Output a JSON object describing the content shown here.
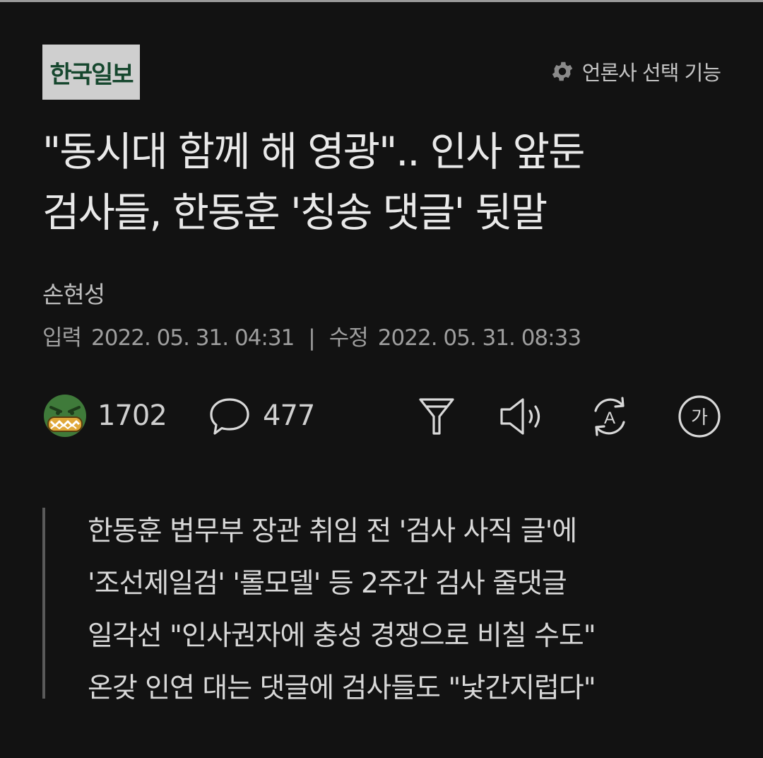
{
  "header": {
    "logo_text": "한국일보",
    "press_select_label": "언론사 선택 기능",
    "press_select_icon": "gear-icon"
  },
  "article": {
    "headline_line1": "\"동시대 함께 해 영광\".. 인사 앞둔",
    "headline_line2": "검사들, 한동훈 '칭송 댓글' 뒷말",
    "author": "손현성",
    "input_label": "입력",
    "input_date": "2022. 05. 31. 04:31",
    "separator": "|",
    "modified_label": "수정",
    "modified_date": "2022. 05. 31. 08:33"
  },
  "toolbar": {
    "reaction_count": "1702",
    "comment_count": "477",
    "reaction_icon": "angry-face-icon",
    "comment_icon": "speech-bubble-icon",
    "filter_icon": "filter-icon",
    "speaker_icon": "speaker-icon",
    "translate_icon": "translate-icon",
    "font_size_icon": "font-size-icon",
    "font_size_glyph": "가",
    "translate_glyph": "A"
  },
  "summary": {
    "lines": [
      "한동훈 법무부 장관 취임 전 '검사 사직 글'에",
      "'조선제일검' '롤모델' 등 2주간 검사 줄댓글",
      "일각선 \"인사권자에 충성 경쟁으로 비칠 수도\"",
      "온갖 인연 대는 댓글에 검사들도 \"낯간지럽다\""
    ]
  },
  "colors": {
    "background": "#121212",
    "logo_bg": "#cfcfcf",
    "logo_text": "#16472e",
    "reaction_green": "#3f7a3a"
  }
}
